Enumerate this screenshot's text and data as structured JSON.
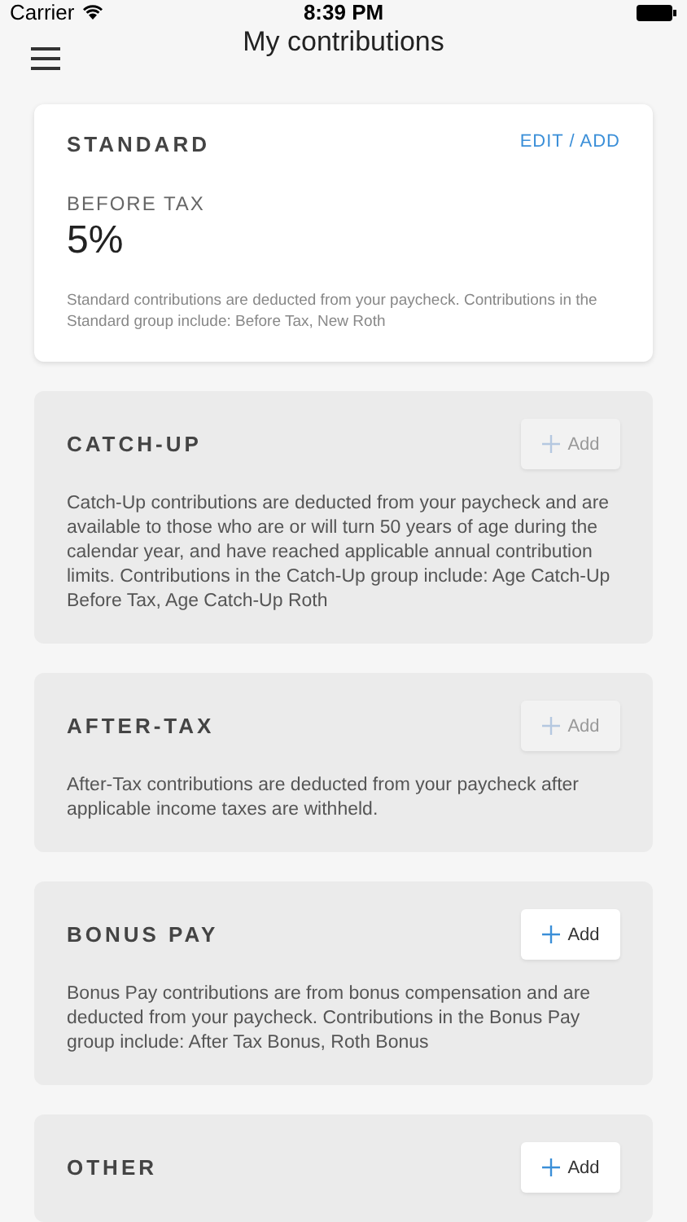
{
  "status_bar": {
    "carrier": "Carrier",
    "time": "8:39 PM"
  },
  "header": {
    "title": "My contributions"
  },
  "groups": [
    {
      "kind": "standard",
      "title": "STANDARD",
      "action": "EDIT / ADD",
      "contributions": [
        {
          "label": "BEFORE TAX",
          "value": "5%"
        }
      ],
      "description": "Standard contributions are deducted from your paycheck. Contributions in the Standard group include: Before Tax, New Roth"
    },
    {
      "kind": "optional",
      "title": "CATCH-UP",
      "action": "Add",
      "disabled": true,
      "description": "Catch-Up contributions are deducted from your paycheck and are available to those who are or will turn 50 years of age during the calendar year, and have reached applicable annual contribution limits. Contributions in the Catch-Up group include: Age Catch-Up Before Tax, Age Catch-Up Roth"
    },
    {
      "kind": "optional",
      "title": "AFTER-TAX",
      "action": "Add",
      "disabled": true,
      "description": "After-Tax contributions are deducted from your paycheck after applicable income taxes are withheld."
    },
    {
      "kind": "optional",
      "title": "BONUS PAY",
      "action": "Add",
      "disabled": false,
      "description": "Bonus Pay contributions are from bonus compensation and are deducted from your paycheck. Contributions in the Bonus Pay group include: After Tax Bonus, Roth Bonus"
    },
    {
      "kind": "optional",
      "title": "OTHER",
      "action": "Add",
      "disabled": false
    }
  ]
}
